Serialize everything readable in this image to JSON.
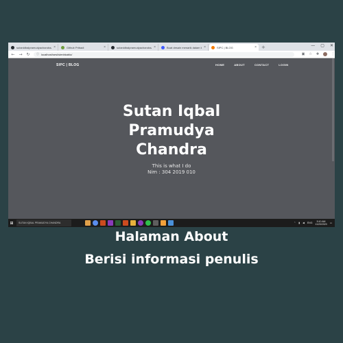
{
  "browser": {
    "tabs": [
      {
        "label": "sutanidbalpramudyachandra/tu",
        "color": "#24292e"
      },
      {
        "label": "Github Pribadi",
        "color": "#6f9c3d"
      },
      {
        "label": "sutanidbalpramudyachandra/tu",
        "color": "#24292e"
      },
      {
        "label": "Buat desain menarik dalam kas",
        "color": "#3d5afe"
      },
      {
        "label": "SIPC | BLOG",
        "color": "#f57c00",
        "active": true
      }
    ],
    "new_tab": "+",
    "window_controls": {
      "minimize": "—",
      "maximize": "▢",
      "close": "✕"
    },
    "address": "localhost/sesi/sienbkablo/"
  },
  "site": {
    "brand": "SIPC | BLOG",
    "nav": [
      "HOME",
      "ABOUT",
      "CONTACT",
      "LOGIN"
    ],
    "hero": {
      "title": [
        "Sutan Iqbal",
        "Pramudya",
        "Chandra"
      ],
      "tagline": "This is what I do",
      "nim": "Nim : 304 2019 010"
    }
  },
  "taskbar": {
    "search_text": "SUTAN IQBAL PRAMUDYA CHANDRA",
    "tray_lang": "ENG",
    "time": "5:10 AM",
    "date": "11/20/2020",
    "app_colors": [
      "#e0a04a",
      "#5a8dee",
      "#cc4b1f",
      "#8a3ab9",
      "#2b5c31",
      "#cc4b1f",
      "#e8b13c",
      "#8a3ab9",
      "#2fbf4a",
      "#5e5e5e",
      "#f3a13b",
      "#4a90d9"
    ]
  },
  "caption": {
    "line1": "Halaman About",
    "line2": "Berisi informasi penulis"
  }
}
